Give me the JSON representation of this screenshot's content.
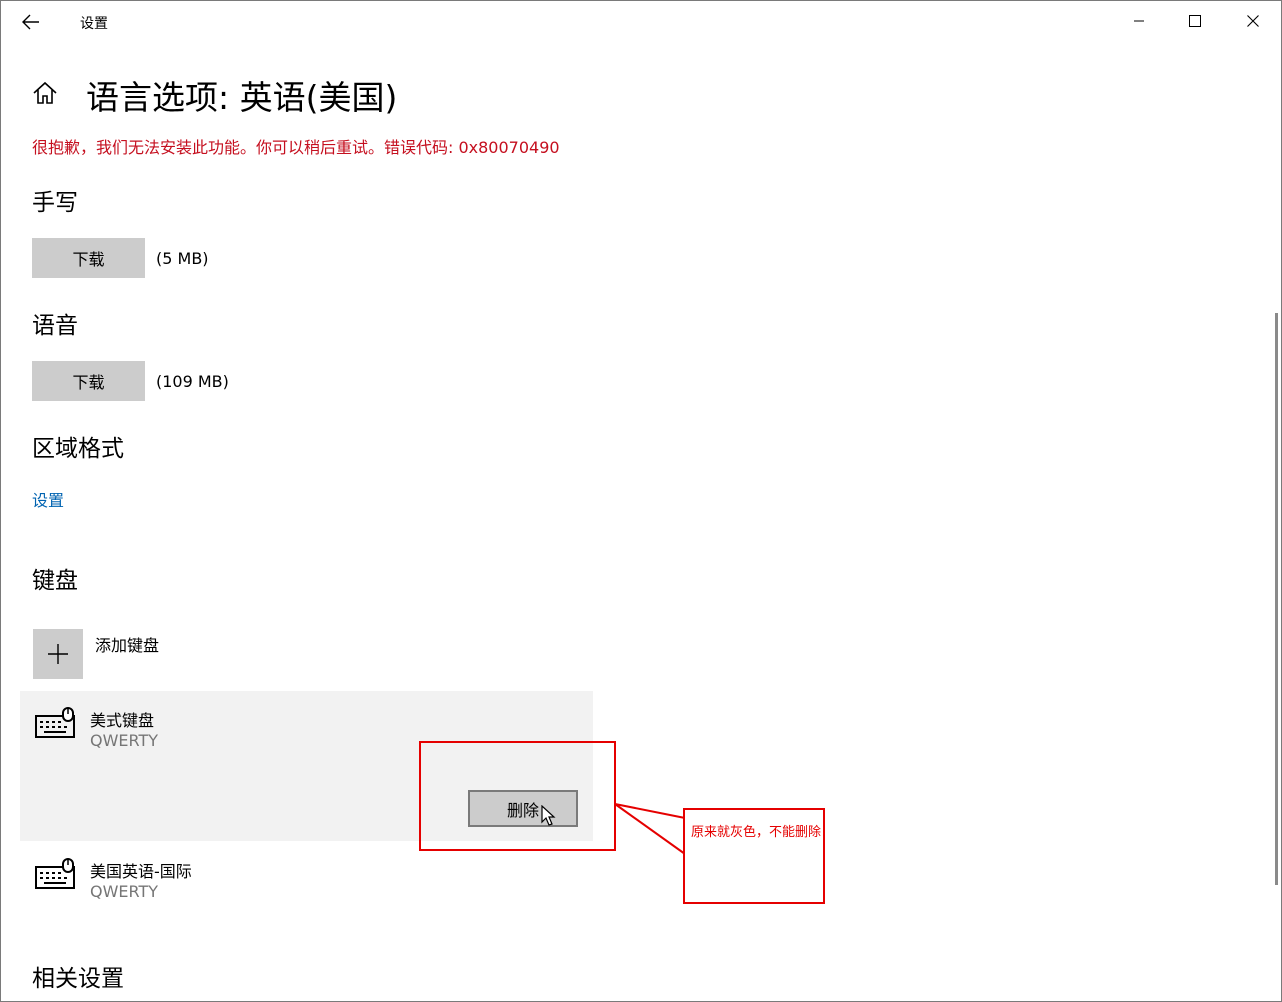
{
  "window": {
    "title": "设置",
    "back_icon": "back-arrow-icon",
    "controls": [
      "minimize-icon",
      "maximize-icon",
      "close-icon"
    ]
  },
  "header": {
    "home_icon": "home-icon",
    "title": "语言选项: 英语(美国)"
  },
  "error": {
    "message": "很抱歉，我们无法安装此功能。你可以稍后重试。错误代码: 0x80070490"
  },
  "handwriting": {
    "title": "手写",
    "download_label": "下载",
    "size": "(5 MB)"
  },
  "speech": {
    "title": "语音",
    "download_label": "下载",
    "size": "(109 MB)"
  },
  "regional": {
    "title": "区域格式",
    "settings_link": "设置"
  },
  "keyboards": {
    "title": "键盘",
    "add_label": "添加键盘",
    "items": [
      {
        "name": "美式键盘",
        "layout": "QWERTY",
        "remove_label": "删除"
      },
      {
        "name": "美国英语-国际",
        "layout": "QWERTY"
      }
    ]
  },
  "related": {
    "title": "相关设置"
  },
  "annotation": {
    "text": "原来就灰色，不能删除",
    "color": "#e50000"
  },
  "colors": {
    "error": "#c50f1f",
    "link": "#0063b1",
    "button_gray": "#cccccc"
  }
}
